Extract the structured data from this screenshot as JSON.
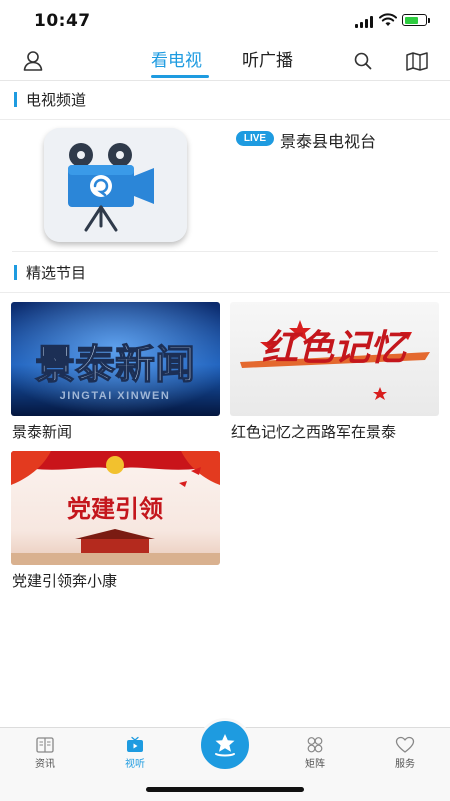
{
  "status_bar": {
    "time": "10:47"
  },
  "top_nav": {
    "tabs": [
      {
        "label": "看电视",
        "active": true
      },
      {
        "label": "听广播",
        "active": false
      }
    ],
    "left_icon": "user-icon",
    "right_icons": [
      "search-icon",
      "map-icon"
    ]
  },
  "tv_channels": {
    "section_title": "电视频道",
    "channels": [
      {
        "live_badge": "LIVE",
        "name": "景泰县电视台",
        "logo_icon": "camera-icon"
      }
    ]
  },
  "featured": {
    "section_title": "精选节目",
    "programs": [
      {
        "title": "景泰新闻",
        "thumb_text": "景泰新闻",
        "thumb_subtext": "JINGTAI XINWEN"
      },
      {
        "title": "红色记忆之西路军在景泰",
        "thumb_text": "红色记忆"
      },
      {
        "title": "党建引领奔小康",
        "thumb_text": "党建引领"
      }
    ]
  },
  "bottom_nav": {
    "items": [
      {
        "label": "资讯",
        "icon": "newspaper-icon",
        "active": false
      },
      {
        "label": "视听",
        "icon": "tv-icon",
        "active": true
      },
      {
        "label": "",
        "icon": "home-star-icon",
        "active": false
      },
      {
        "label": "矩阵",
        "icon": "matrix-icon",
        "active": false
      },
      {
        "label": "服务",
        "icon": "heart-icon",
        "active": false
      }
    ]
  },
  "colors": {
    "accent": "#1e9be0",
    "battery": "#2ecc40"
  }
}
